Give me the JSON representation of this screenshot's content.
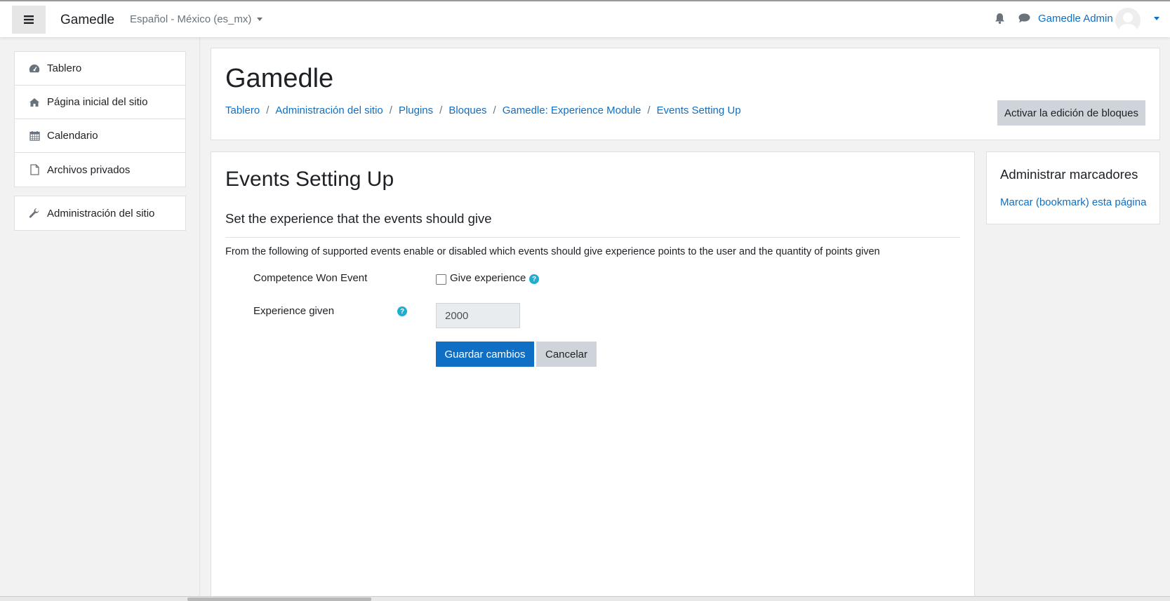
{
  "navbar": {
    "brand": "Gamedle",
    "language": "Español - México (es_mx)",
    "username": "Gamedle Admin"
  },
  "drawer": {
    "items": [
      {
        "label": "Tablero",
        "icon": "dashboard-icon"
      },
      {
        "label": "Página inicial del sitio",
        "icon": "home-icon"
      },
      {
        "label": "Calendario",
        "icon": "calendar-icon"
      },
      {
        "label": "Archivos privados",
        "icon": "file-icon"
      }
    ],
    "admin": {
      "label": "Administración del sitio",
      "icon": "wrench-icon"
    }
  },
  "header": {
    "title": "Gamedle",
    "breadcrumb": [
      "Tablero",
      "Administración del sitio",
      "Plugins",
      "Bloques",
      "Gamedle: Experience Module",
      "Events Setting Up"
    ],
    "edit_button": "Activar la edición de bloques"
  },
  "main": {
    "heading": "Events Setting Up",
    "section_heading": "Set the experience that the events should give",
    "description": "From the following of supported events enable or disabled which events should give experience points to the user and the quantity of points given",
    "event_label": "Competence Won Event",
    "checkbox_label": "Give experience",
    "checkbox_checked": false,
    "experience_label": "Experience given",
    "experience_value": "2000",
    "save_button": "Guardar cambios",
    "cancel_button": "Cancelar"
  },
  "block": {
    "title": "Administrar marcadores",
    "link": "Marcar (bookmark) esta página"
  },
  "colors": {
    "primary": "#0f6fc5",
    "help": "#1faecf",
    "background": "#f2f2f2"
  }
}
